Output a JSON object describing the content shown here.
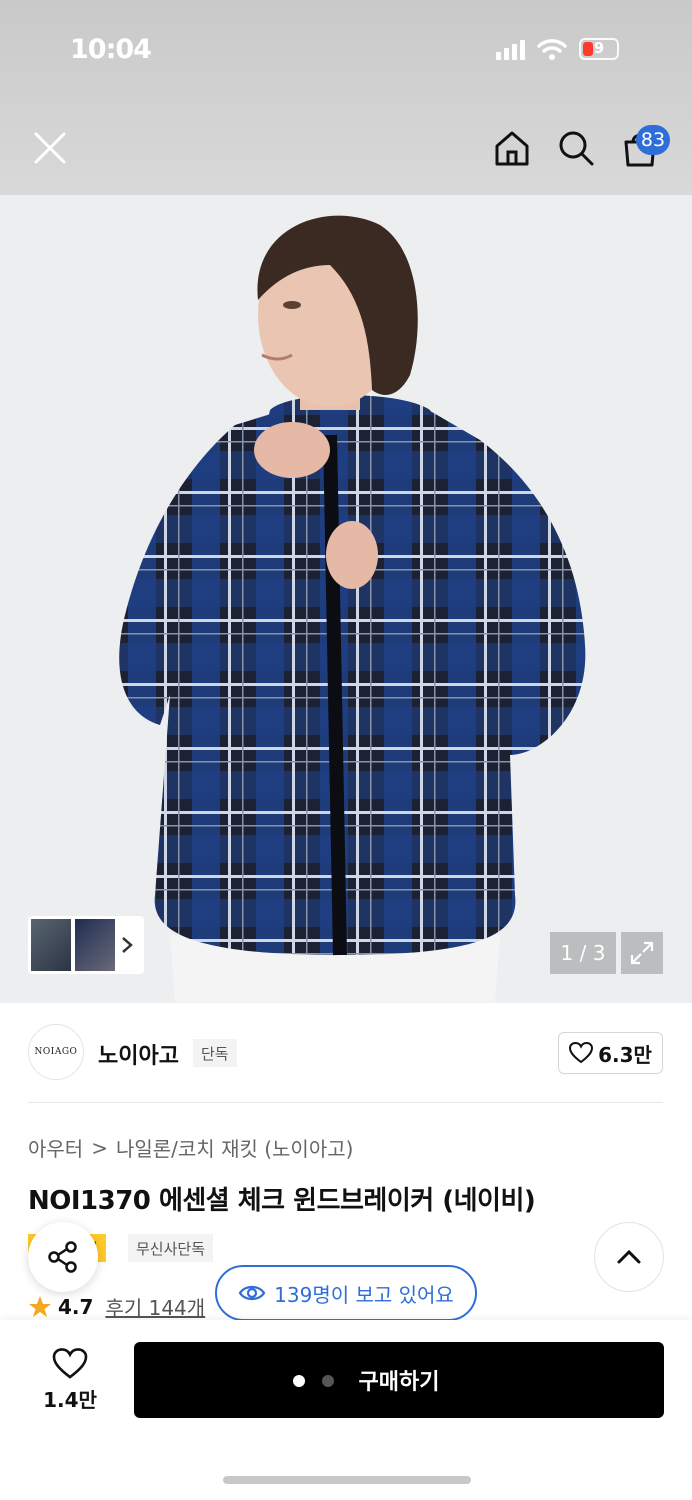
{
  "status": {
    "time": "10:04",
    "battery": "9"
  },
  "nav": {
    "cart_count": "83"
  },
  "gallery": {
    "pager": "1 / 3"
  },
  "brand": {
    "logo_text": "NOIAGO",
    "name": "노이아고",
    "exclusive_tag": "단독",
    "likes": "6.3만"
  },
  "breadcrumb": {
    "level1": "아우터",
    "separator": ">",
    "level2": "나일론/코치 재킷 (노이아고)"
  },
  "product": {
    "title": "NOI1370 에센셜 체크 윈드브레이커 (네이비)",
    "tag_sale": "일",
    "tag_exclusive": "무신사단독"
  },
  "viewers": {
    "text": "139명이 보고 있어요"
  },
  "rating": {
    "score": "4.7",
    "reviews": "후기 144개"
  },
  "bottom": {
    "favorite_count": "1.4만",
    "buy_label": "구매하기"
  },
  "colors": {
    "accent": "#2f6ed8",
    "star": "#f5a623",
    "buy_button": "#000000"
  }
}
